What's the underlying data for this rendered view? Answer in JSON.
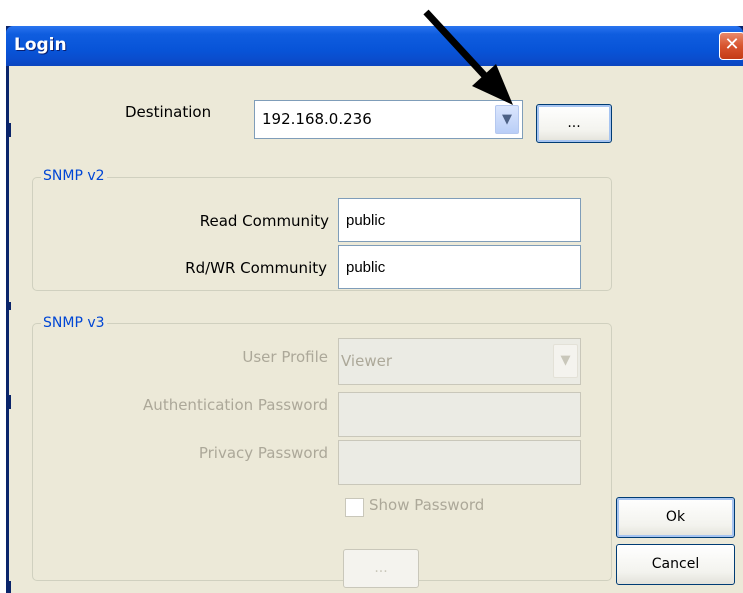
{
  "window": {
    "title": "Login",
    "close_glyph": "✕"
  },
  "destination": {
    "label": "Destination",
    "value": "192.168.0.236",
    "dropdown_icon": "chevron-down-icon",
    "browse_label": "..."
  },
  "snmp_v2": {
    "group_label": "SNMP v2",
    "read_community_label": "Read Community",
    "read_community_value": "public",
    "rdwr_community_label": "Rd/WR Community",
    "rdwr_community_value": "public"
  },
  "snmp_v3": {
    "group_label": "SNMP v3",
    "user_profile_label": "User Profile",
    "user_profile_value": "Viewer",
    "auth_password_label": "Authentication Password",
    "privacy_password_label": "Privacy Password",
    "show_password_label": "Show Password",
    "browse_label": "...",
    "disabled_color": "#aca899"
  },
  "buttons": {
    "ok_label": "Ok",
    "cancel_label": "Cancel"
  },
  "annotation": {
    "icon": "arrow-icon",
    "color": "#000000"
  }
}
